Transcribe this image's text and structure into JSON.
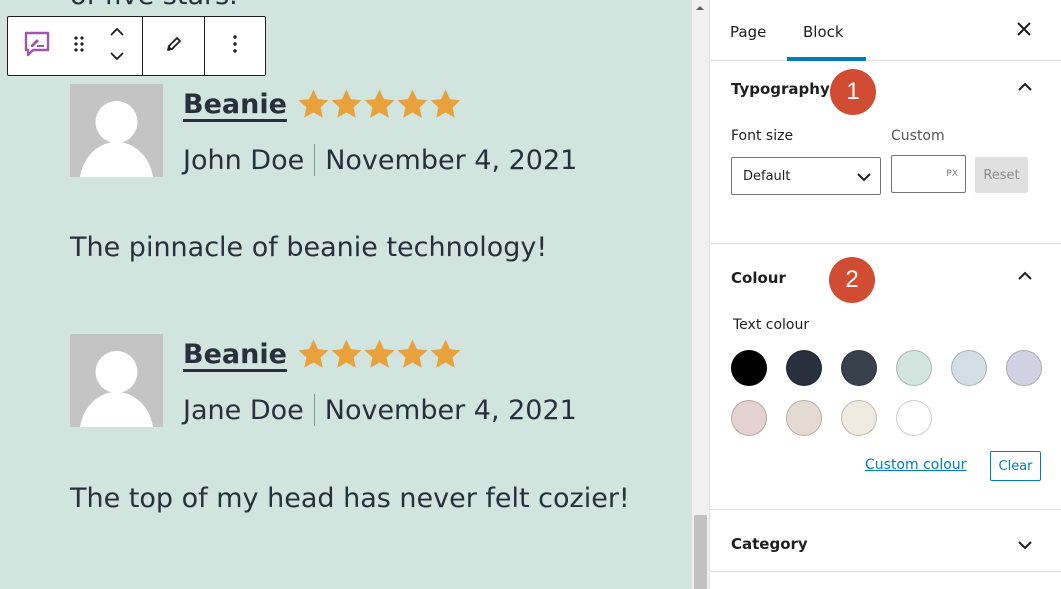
{
  "canvas": {
    "top_text": "of five stars.",
    "toolbar": {
      "icons": [
        "review-block-icon",
        "drag-handle-icon",
        "move-up-icon",
        "move-down-icon",
        "edit-pencil-icon",
        "more-options-icon"
      ]
    },
    "reviews": [
      {
        "product": "Beanie",
        "rating": 5,
        "rating_max": 5,
        "author": "John Doe",
        "date": "November 4, 2021",
        "content": "The pinnacle of beanie technology!"
      },
      {
        "product": "Beanie",
        "rating": 5,
        "rating_max": 5,
        "author": "Jane Doe",
        "date": "November 4, 2021",
        "content": "The top of my head has never felt cozier!"
      }
    ],
    "star_color": "#e9a23b"
  },
  "sidebar": {
    "tabs": [
      {
        "label": "Page",
        "active": false
      },
      {
        "label": "Block",
        "active": true
      }
    ],
    "accent": "#007cba",
    "typography": {
      "title": "Typography",
      "badge": "1",
      "font_size_label": "Font size",
      "font_size_value": "Default",
      "custom_label": "Custom",
      "custom_value": "",
      "unit": "PX",
      "reset_label": "Reset"
    },
    "colour": {
      "title": "Colour",
      "badge": "2",
      "text_colour_label": "Text colour",
      "swatches": [
        "#000000",
        "#28303d",
        "#39414d",
        "#d1e4dd",
        "#d1dfe4",
        "#d1d1e4",
        "#e4d1d1",
        "#e4dad1",
        "#eeeadd",
        "#ffffff"
      ],
      "custom_colour_label": "Custom colour",
      "clear_label": "Clear"
    },
    "category": {
      "title": "Category"
    },
    "badge_color": "#d04c32"
  }
}
